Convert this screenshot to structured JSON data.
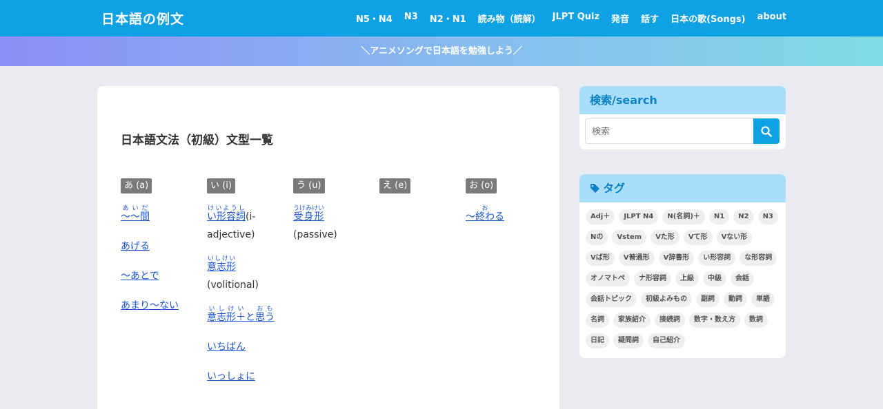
{
  "header": {
    "logo": "日本語の例文",
    "nav": [
      "N5・N4",
      "N3",
      "N2・N1",
      "読み物（読解）",
      "JLPT Quiz",
      "発音",
      "話す",
      "日本の歌(Songs)",
      "about"
    ]
  },
  "banner": "＼アニメソングで日本語を勉強しよう／",
  "main": {
    "title": "日本語文法（初級）文型一覧",
    "columns": [
      {
        "head": "あ (a)",
        "items": [
          {
            "text": "～間",
            "ruby": "あいだ"
          },
          {
            "text": "あげる"
          },
          {
            "text": "～あとで"
          },
          {
            "text": "あまり～ない"
          }
        ]
      },
      {
        "head": "い (i)",
        "items": [
          {
            "text": "い形容詞",
            "ruby": "けいようし",
            "suffix": "(i-adjective)"
          },
          {
            "text": "意志形",
            "ruby": "いしけい",
            "suffix": "(volitional)"
          },
          {
            "text": "意志形＋と思う",
            "ruby": "いしけい　おも"
          },
          {
            "text": "いちばん"
          },
          {
            "text": "いっしょに"
          }
        ]
      },
      {
        "head": "う (u)",
        "items": [
          {
            "text": "受身形",
            "ruby": "うけみけい",
            "suffix": "(passive)"
          }
        ]
      },
      {
        "head": "え (e)",
        "items": []
      },
      {
        "head": "お (o)",
        "items": [
          {
            "text": "～終わる",
            "ruby": "お"
          }
        ]
      }
    ]
  },
  "sidebar": {
    "search": {
      "title": "検索/search",
      "placeholder": "検索"
    },
    "tags": {
      "title": "タグ",
      "items": [
        "Adj＋",
        "JLPT N4",
        "N(名詞)＋",
        "N1",
        "N2",
        "N3",
        "Nの",
        "Vstem",
        "Vた形",
        "Vて形",
        "Vない形",
        "Vば形",
        "V普通形",
        "V辞書形",
        "い形容詞",
        "な形容詞",
        "オノマトペ",
        "ナ形容詞",
        "上級",
        "中級",
        "会話",
        "会話トピック",
        "初級よみもの",
        "副詞",
        "動詞",
        "単語",
        "名詞",
        "家族紹介",
        "接続詞",
        "数字・数え方",
        "数詞",
        "日記",
        "疑問詞",
        "自己紹介"
      ]
    }
  },
  "colors": {
    "header": "#0ea1e4",
    "link": "#1a55d6",
    "widget_head": "#a8def9"
  }
}
